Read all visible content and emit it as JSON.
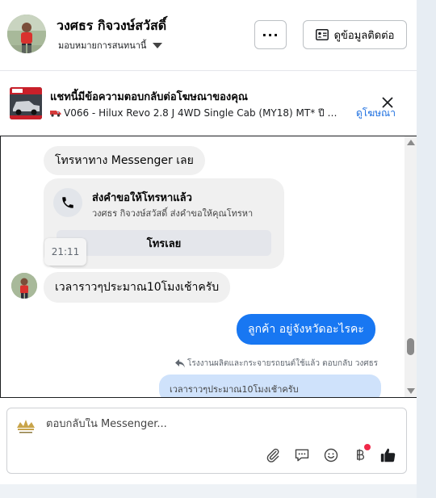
{
  "header": {
    "name": "วงศธร กิจวงษ์สวัสดิ์",
    "assign_label": "มอบหมายการสนทนานี้",
    "more_label": "···",
    "contact_label": "ดูข้อมูลติดต่อ"
  },
  "ad": {
    "title": "แชทนี้มีข้อความตอบกลับต่อโฆษณาของคุณ",
    "subtitle": "V066 - Hilux Revo 2.8 J 4WD Single Cab (MY18) MT* ปี 2018 ...",
    "link_label": "ดูโฆษณา"
  },
  "conversation": {
    "msg1": "โทรหาทาง Messenger เลย",
    "call_title": "ส่งคำขอให้โทรหาแล้ว",
    "call_desc": "วงศธร กิจวงษ์สวัสดิ์ ส่งคำขอให้คุณโทรหา",
    "call_button": "โทรเลย",
    "timestamp": "21:11",
    "msg2": "เวลาราวๆประมาณ10โมงเช้าครับ",
    "msg3": "ลูกค้า อยู่จังหวัดอะไรคะ",
    "reply_meta": "โรงงานผลิตและกระจายรถยนต์ใช้แล้ว ตอบกลับ วงศธร",
    "quoted": "เวลาราวๆประมาณ10โมงเช้าครับ"
  },
  "composer": {
    "placeholder": "ตอบกลับใน Messenger..."
  },
  "colors": {
    "accent": "#1877f2",
    "bubble_gray": "#f0f0f0",
    "notification_dot": "#f02849"
  },
  "icons": [
    "person-photo",
    "contact-card-icon",
    "close-icon",
    "phone-icon",
    "reply-arrow-icon",
    "paperclip-icon",
    "chat-bubble-icon",
    "smiley-icon",
    "baht-icon",
    "thumbs-up-icon"
  ]
}
